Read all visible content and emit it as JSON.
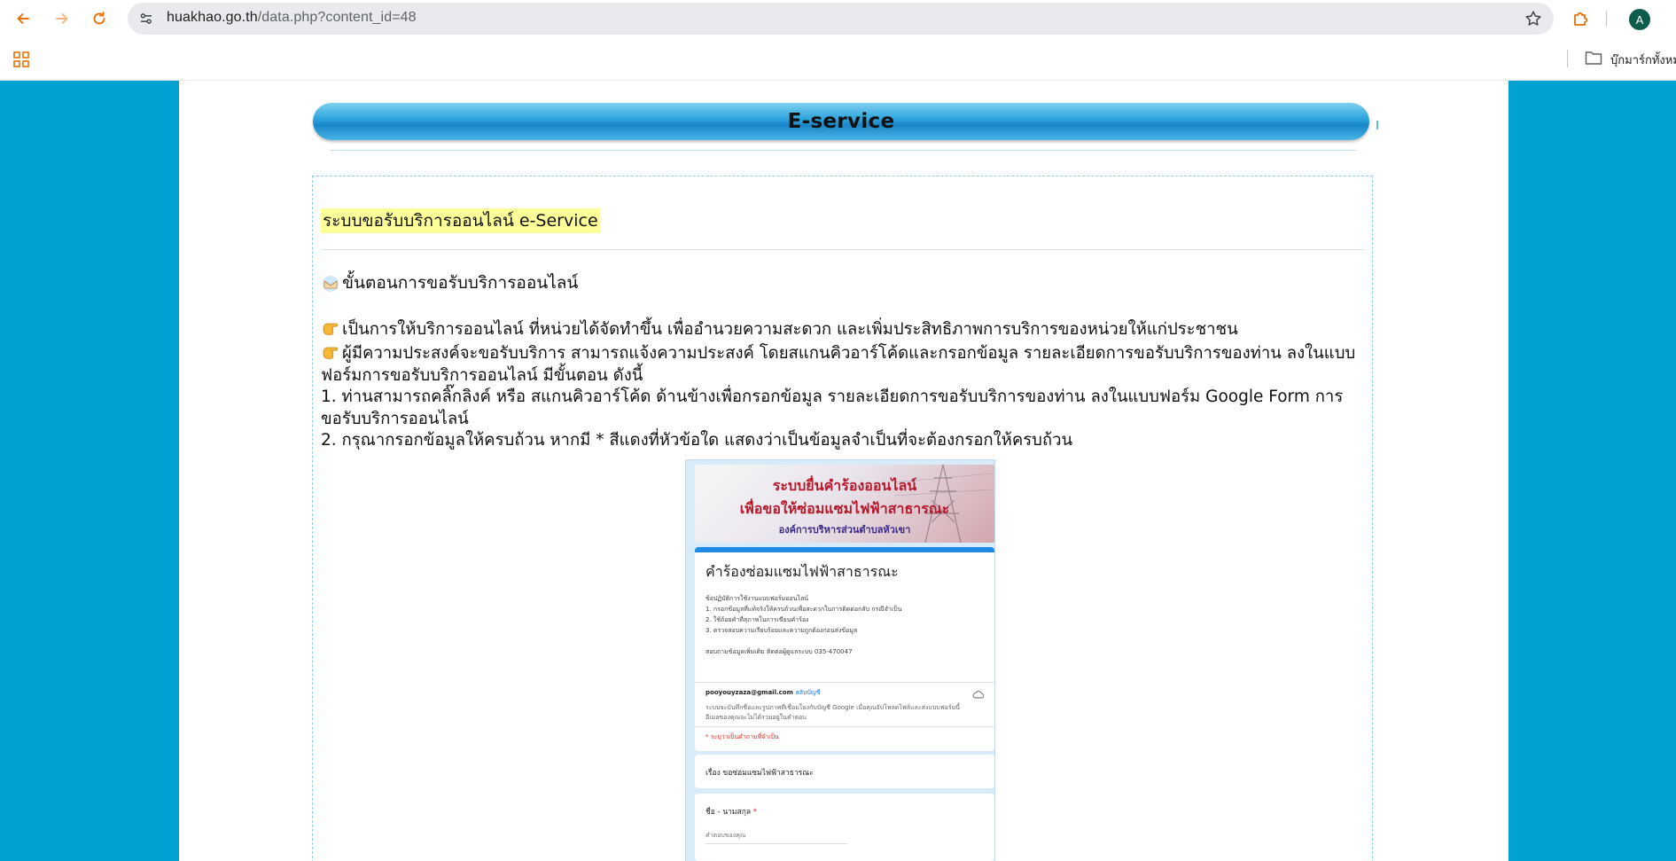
{
  "browser": {
    "url_host": "huakhao.go.th",
    "url_path": "/data.php?content_id=48",
    "avatar_letter": "A",
    "bookmark_folder_label": "บุ๊กมาร์กทั้งหม"
  },
  "page": {
    "banner_title": "E-service",
    "headline": "ระบบขอรับบริการออนไลน์ e-Service",
    "section_title": "ขั้นตอนการขอรับบริการออนไลน์",
    "bullet_1": "เป็นการให้บริการออนไลน์ ที่หน่วยได้จัดทำขึ้น เพื่ออำนวยความสะดวก และเพิ่มประสิทธิภาพการบริการของหน่วยให้แก่ประชาชน",
    "bullet_2": "ผู้มีความประสงค์จะขอรับบริการ สามารถแจ้งความประสงค์ โดยสแกนคิวอาร์โค้ดและกรอกข้อมูล รายละเอียดการขอรับบริการของท่าน ลงในแบบฟอร์มการขอรับบริการออนไลน์ มีขั้นตอน ดังนี้",
    "step_1": "1. ท่านสามารถคลิ๊กลิงค์ หรือ สแกนคิวอาร์โค้ด ด้านข้างเพื่อกรอกข้อมูล รายละเอียดการขอรับบริการของท่าน ลงในแบบฟอร์ม Google Form การขอรับบริการออนไลน์",
    "step_2": "2. กรุณากรอกข้อมูลให้ครบถ้วน หากมี * สีแดงที่หัวข้อใด แสดงว่าเป็นข้อมูลจำเป็นที่จะต้องกรอกให้ครบถ้วน"
  },
  "form_image": {
    "banner_line_1": "ระบบยื่นคำร้องออนไลน์",
    "banner_line_2": "เพื่อขอให้ซ่อมแซมไฟฟ้าสาธารณะ",
    "banner_line_3": "องค์การบริหารส่วนตำบลหัวเขา",
    "form_title": "คำร้องซ่อมแซมไฟฟ้าสาธารณะ",
    "instructions_heading": "ข้อปฏิบัติการใช้งานแบบฟอร์มออนไลน์",
    "instruction_1": "1. กรอกข้อมูลที่แท้จริงให้ครบถ้วนเพื่อสะดวกในการติดต่อกลับ กรณีจำเป็น",
    "instruction_2": "2. ใช้ถ้อยคำที่สุภาพในการเขียนคำร้อง",
    "instruction_3": "3. ตรวจสอบความเรียบร้อยและความถูกต้องก่อนส่งข้อมูล",
    "contact": "สอบถามข้อมูลเพิ่มเติม ติดต่อผู้ดูแลระบบ 035-470047",
    "account_email": "pooyouyzaza@gmail.com",
    "switch_account": "สลับบัญชี",
    "privacy_line_1": "ระบบจะบันทึกชื่อและรูปภาพที่เชื่อมโยงกับบัญชี Google เมื่อคุณอัปโหลดไฟล์และส่งแบบฟอร์มนี้",
    "privacy_line_2": "อีเมลของคุณจะไม่ได้รวมอยู่ในคำตอบ",
    "required_note": "* ระบุว่าเป็นคำถามที่จำเป็น",
    "subject_label": "เรื่อง ขอซ่อมแซมไฟฟ้าสาธารณะ",
    "name_label": "ชื่อ - นามสกุล",
    "name_required": "*",
    "name_placeholder": "คำตอบของคุณ"
  }
}
